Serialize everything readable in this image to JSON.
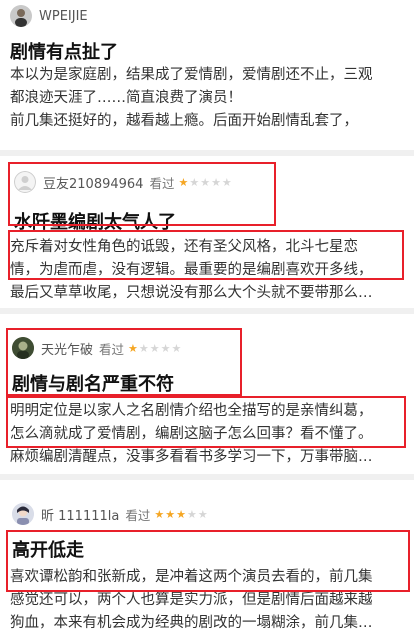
{
  "reviews": [
    {
      "username": "WPEIJIE",
      "title": "剧情有点扯了",
      "lines": [
        "本以为是家庭剧，结果成了爱情剧，爱情剧还不止，三观",
        "都浪迹天涯了……简直浪费了演员！",
        "前几集还挺好的，越看越上瘾。后面开始剧情乱套了，"
      ]
    },
    {
      "username": "豆友210894964",
      "watched": "看过",
      "rating": 1,
      "title": "水阡墨编剧太气人了",
      "lines": [
        "充斥着对女性角色的诋毁，还有圣父风格，北斗七星恋",
        "情，为虐而虐，没有逻辑。最重要的是编剧喜欢开多线，",
        "最后又草草收尾，只想说没有那么大个头就不要带那么…"
      ]
    },
    {
      "username": "天光乍破",
      "watched": "看过",
      "rating": 1,
      "title": "剧情与剧名严重不符",
      "lines": [
        "明明定位是以家人之名剧情介绍也全描写的是亲情纠葛，",
        "怎么滴就成了爱情剧，编剧这脑子怎么回事？看不懂了。",
        "麻烦编剧清醒点，没事多看看书多学习一下，万事带脑…"
      ]
    },
    {
      "username": "昕 111111la",
      "watched": "看过",
      "rating": 3,
      "title": "高开低走",
      "lines": [
        "喜欢谭松韵和张新成，是冲着这两个演员去看的，前几集",
        "感觉还可以，两个人也算是实力派，但是剧情后面越来越",
        "狗血，本来有机会成为经典的剧改的一塌糊涂，前几集…"
      ]
    }
  ],
  "colors": {
    "highlight_box": "#e8202a",
    "star_on": "#f5a623",
    "star_off": "#d6d6d6"
  }
}
